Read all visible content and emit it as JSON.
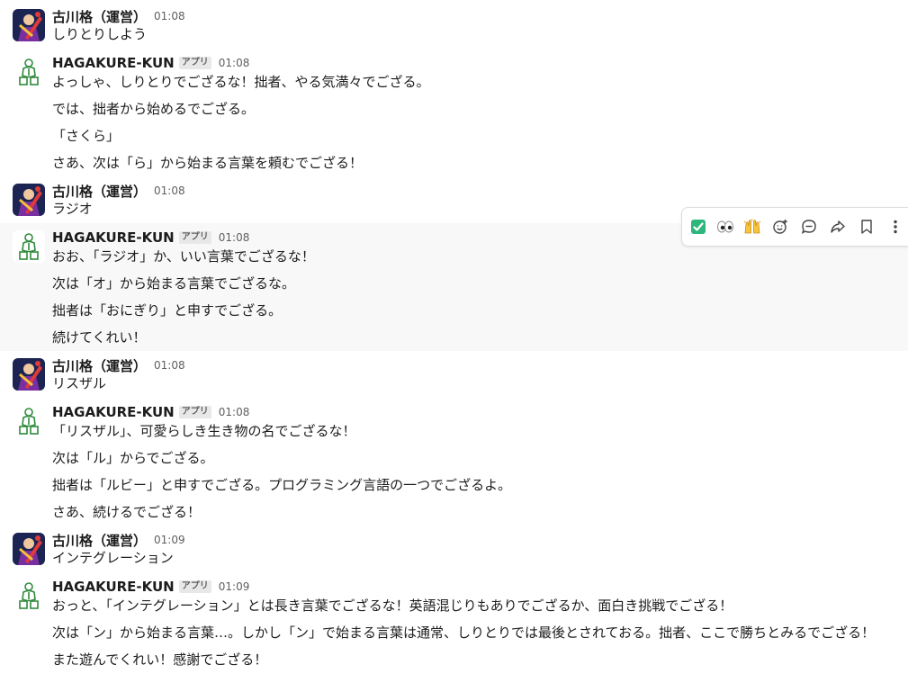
{
  "users": {
    "human": {
      "name": "古川格（運営）"
    },
    "bot": {
      "name": "HAGAKURE-KUN",
      "badge": "アプリ"
    }
  },
  "messages": [
    {
      "time": "01:08",
      "lines": [
        "しりとりしよう"
      ]
    },
    {
      "time": "01:08",
      "lines": [
        "よっしゃ、しりとりでござるな！拙者、やる気満々でござる。",
        "では、拙者から始めるでござる。",
        "「さくら」",
        "さあ、次は「ら」から始まる言葉を頼むでござる！"
      ]
    },
    {
      "time": "01:08",
      "lines": [
        "ラジオ"
      ]
    },
    {
      "time": "01:08",
      "lines": [
        "おお、「ラジオ」か、いい言葉でござるな！",
        "次は「オ」から始まる言葉でござるな。",
        "拙者は「おにぎり」と申すでござる。",
        "続けてくれい！"
      ]
    },
    {
      "time": "01:08",
      "lines": [
        "リスザル"
      ]
    },
    {
      "time": "01:08",
      "lines": [
        "「リスザル」、可愛らしき生き物の名でござるな！",
        "次は「ル」からでござる。",
        "拙者は「ルビー」と申すでござる。プログラミング言語の一つでござるよ。",
        "さあ、続けるでござる！"
      ]
    },
    {
      "time": "01:09",
      "lines": [
        "インテグレーション"
      ]
    },
    {
      "time": "01:09",
      "lines": [
        "おっと、「インテグレーション」とは長き言葉でござるな！英語混じりもありでござるか、面白き挑戦でござる！",
        "次は「ン」から始まる言葉…。しかし「ン」で始まる言葉は通常、しりとりでは最後とされておる。拙者、ここで勝ちとみるでござる！",
        "また遊んでくれい！感謝でござる！"
      ]
    }
  ],
  "toolbar": {
    "icons": [
      "check-mark-emoji",
      "eyes-emoji",
      "raised-hands-emoji",
      "add-reaction-icon",
      "reply-thread-icon",
      "forward-icon",
      "bookmark-icon",
      "more-actions-icon"
    ]
  },
  "colors": {
    "hover_bg": "#f8f8f8",
    "bot_green": "#2f8b3c",
    "check_green": "#2eb67d"
  }
}
